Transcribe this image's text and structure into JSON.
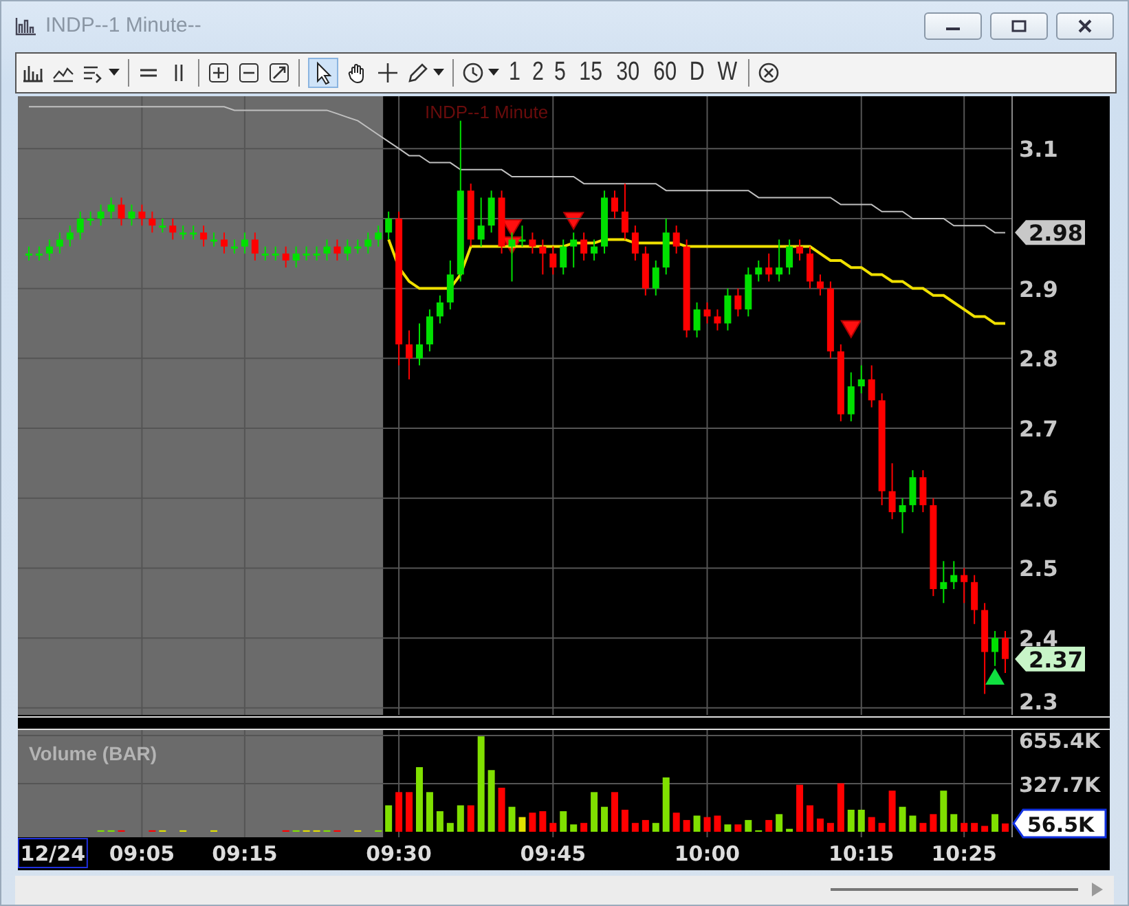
{
  "window": {
    "title": "INDP--1 Minute--"
  },
  "toolbar": {
    "periods": [
      {
        "label": "1"
      },
      {
        "label": "2"
      },
      {
        "label": "5"
      },
      {
        "label": "15"
      },
      {
        "label": "30"
      },
      {
        "label": "60"
      },
      {
        "label": "D"
      },
      {
        "label": "W"
      }
    ]
  },
  "chart": {
    "title": "INDP--1 Minute",
    "price": {
      "badges": [
        {
          "text": "2.98",
          "kind": "average",
          "color": "#c8c8c8"
        },
        {
          "text": "2.37",
          "kind": "last",
          "color": "#c8f5c8"
        }
      ],
      "chart_data": {
        "type": "candlestick",
        "grid": true,
        "ylim": [
          2.29,
          3.175
        ],
        "yticks": [
          {
            "value": 3.1,
            "label": "3.1"
          },
          {
            "value": 2.9,
            "label": "2.9"
          },
          {
            "value": 2.8,
            "label": "2.8"
          },
          {
            "value": 2.7,
            "label": "2.7"
          },
          {
            "value": 2.6,
            "label": "2.6"
          },
          {
            "value": 2.5,
            "label": "2.5"
          },
          {
            "value": 2.4,
            "label": "2.4"
          },
          {
            "value": 2.3,
            "label": "2.3"
          }
        ],
        "ohlc": [
          [
            2.95,
            2.96,
            2.94,
            2.95
          ],
          [
            2.95,
            2.96,
            2.94,
            2.95
          ],
          [
            2.95,
            2.97,
            2.94,
            2.96
          ],
          [
            2.96,
            2.98,
            2.95,
            2.97
          ],
          [
            2.97,
            2.99,
            2.96,
            2.98
          ],
          [
            2.98,
            3.01,
            2.97,
            3.0
          ],
          [
            3.0,
            3.01,
            2.99,
            3.0
          ],
          [
            3.0,
            3.02,
            2.99,
            3.01
          ],
          [
            3.01,
            3.03,
            3.0,
            3.02
          ],
          [
            3.02,
            3.03,
            2.99,
            3.0
          ],
          [
            3.0,
            3.02,
            2.99,
            3.01
          ],
          [
            3.01,
            3.02,
            2.99,
            3.0
          ],
          [
            3.0,
            3.01,
            2.98,
            2.99
          ],
          [
            2.99,
            3.0,
            2.98,
            2.99
          ],
          [
            2.99,
            3.0,
            2.97,
            2.98
          ],
          [
            2.98,
            2.99,
            2.97,
            2.98
          ],
          [
            2.98,
            2.99,
            2.97,
            2.98
          ],
          [
            2.98,
            2.99,
            2.96,
            2.97
          ],
          [
            2.97,
            2.98,
            2.96,
            2.97
          ],
          [
            2.97,
            2.98,
            2.95,
            2.96
          ],
          [
            2.96,
            2.97,
            2.95,
            2.96
          ],
          [
            2.96,
            2.98,
            2.95,
            2.97
          ],
          [
            2.97,
            2.98,
            2.94,
            2.95
          ],
          [
            2.95,
            2.96,
            2.94,
            2.95
          ],
          [
            2.95,
            2.96,
            2.94,
            2.95
          ],
          [
            2.95,
            2.96,
            2.93,
            2.94
          ],
          [
            2.94,
            2.96,
            2.93,
            2.95
          ],
          [
            2.95,
            2.96,
            2.94,
            2.95
          ],
          [
            2.95,
            2.96,
            2.94,
            2.95
          ],
          [
            2.95,
            2.97,
            2.94,
            2.96
          ],
          [
            2.96,
            2.97,
            2.94,
            2.95
          ],
          [
            2.95,
            2.97,
            2.94,
            2.96
          ],
          [
            2.96,
            2.97,
            2.95,
            2.96
          ],
          [
            2.96,
            2.98,
            2.95,
            2.97
          ],
          [
            2.97,
            2.99,
            2.96,
            2.98
          ],
          [
            2.98,
            3.01,
            2.97,
            3.0
          ],
          [
            3.0,
            3.01,
            2.79,
            2.82
          ],
          [
            2.82,
            2.84,
            2.77,
            2.8
          ],
          [
            2.8,
            2.85,
            2.79,
            2.82
          ],
          [
            2.82,
            2.87,
            2.81,
            2.86
          ],
          [
            2.86,
            2.89,
            2.85,
            2.88
          ],
          [
            2.88,
            2.94,
            2.87,
            2.92
          ],
          [
            2.92,
            3.14,
            2.91,
            3.04
          ],
          [
            3.04,
            3.05,
            2.96,
            2.97
          ],
          [
            2.97,
            3.03,
            2.96,
            2.99
          ],
          [
            2.99,
            3.04,
            2.98,
            3.03
          ],
          [
            3.03,
            3.04,
            2.95,
            2.96
          ],
          [
            2.96,
            2.98,
            2.91,
            2.97
          ],
          [
            2.97,
            2.99,
            2.96,
            2.97
          ],
          [
            2.97,
            2.98,
            2.95,
            2.96
          ],
          [
            2.96,
            2.97,
            2.92,
            2.95
          ],
          [
            2.95,
            2.96,
            2.92,
            2.93
          ],
          [
            2.93,
            2.97,
            2.92,
            2.96
          ],
          [
            2.96,
            2.98,
            2.93,
            2.97
          ],
          [
            2.97,
            2.98,
            2.94,
            2.95
          ],
          [
            2.95,
            2.97,
            2.94,
            2.96
          ],
          [
            2.96,
            3.04,
            2.95,
            3.03
          ],
          [
            3.03,
            3.04,
            3.0,
            3.01
          ],
          [
            3.01,
            3.05,
            2.97,
            2.98
          ],
          [
            2.98,
            2.99,
            2.94,
            2.95
          ],
          [
            2.95,
            2.96,
            2.89,
            2.9
          ],
          [
            2.9,
            2.94,
            2.89,
            2.93
          ],
          [
            2.93,
            3.0,
            2.92,
            2.98
          ],
          [
            2.98,
            2.99,
            2.95,
            2.96
          ],
          [
            2.96,
            2.97,
            2.83,
            2.84
          ],
          [
            2.84,
            2.88,
            2.83,
            2.87
          ],
          [
            2.87,
            2.88,
            2.85,
            2.86
          ],
          [
            2.86,
            2.87,
            2.84,
            2.85
          ],
          [
            2.85,
            2.9,
            2.84,
            2.89
          ],
          [
            2.89,
            2.9,
            2.86,
            2.87
          ],
          [
            2.87,
            2.93,
            2.86,
            2.92
          ],
          [
            2.92,
            2.94,
            2.91,
            2.93
          ],
          [
            2.93,
            2.95,
            2.91,
            2.92
          ],
          [
            2.92,
            2.97,
            2.91,
            2.93
          ],
          [
            2.93,
            2.97,
            2.92,
            2.96
          ],
          [
            2.96,
            2.97,
            2.94,
            2.95
          ],
          [
            2.95,
            2.96,
            2.9,
            2.91
          ],
          [
            2.91,
            2.92,
            2.89,
            2.9
          ],
          [
            2.9,
            2.91,
            2.8,
            2.81
          ],
          [
            2.81,
            2.82,
            2.71,
            2.72
          ],
          [
            2.72,
            2.78,
            2.71,
            2.76
          ],
          [
            2.76,
            2.79,
            2.75,
            2.77
          ],
          [
            2.77,
            2.79,
            2.73,
            2.74
          ],
          [
            2.74,
            2.75,
            2.59,
            2.61
          ],
          [
            2.61,
            2.65,
            2.57,
            2.58
          ],
          [
            2.58,
            2.6,
            2.55,
            2.59
          ],
          [
            2.59,
            2.64,
            2.58,
            2.63
          ],
          [
            2.63,
            2.64,
            2.58,
            2.59
          ],
          [
            2.59,
            2.6,
            2.46,
            2.47
          ],
          [
            2.47,
            2.51,
            2.45,
            2.48
          ],
          [
            2.48,
            2.51,
            2.47,
            2.49
          ],
          [
            2.49,
            2.5,
            2.45,
            2.48
          ],
          [
            2.48,
            2.49,
            2.42,
            2.44
          ],
          [
            2.44,
            2.45,
            2.32,
            2.38
          ],
          [
            2.38,
            2.41,
            2.36,
            2.4
          ],
          [
            2.4,
            2.41,
            2.35,
            2.37
          ]
        ],
        "series": [
          {
            "type": "line",
            "color": "#c0c0c0",
            "values": [
              3.16,
              3.16,
              3.16,
              3.16,
              3.16,
              3.16,
              3.16,
              3.16,
              3.16,
              3.16,
              3.16,
              3.16,
              3.16,
              3.16,
              3.16,
              3.16,
              3.16,
              3.16,
              3.16,
              3.16,
              3.155,
              3.155,
              3.155,
              3.155,
              3.155,
              3.155,
              3.155,
              3.155,
              3.155,
              3.155,
              3.15,
              3.145,
              3.14,
              3.13,
              3.12,
              3.11,
              3.1,
              3.09,
              3.09,
              3.08,
              3.08,
              3.08,
              3.07,
              3.07,
              3.07,
              3.07,
              3.07,
              3.06,
              3.06,
              3.06,
              3.06,
              3.06,
              3.06,
              3.06,
              3.05,
              3.05,
              3.05,
              3.05,
              3.05,
              3.05,
              3.05,
              3.05,
              3.04,
              3.04,
              3.04,
              3.04,
              3.04,
              3.04,
              3.04,
              3.04,
              3.04,
              3.03,
              3.03,
              3.03,
              3.03,
              3.03,
              3.03,
              3.03,
              3.03,
              3.02,
              3.02,
              3.02,
              3.02,
              3.01,
              3.01,
              3.01,
              3.0,
              3.0,
              3.0,
              3.0,
              2.99,
              2.99,
              2.99,
              2.99,
              2.98,
              2.98
            ]
          },
          {
            "type": "line",
            "color": "#f0e000",
            "values": [
              null,
              null,
              null,
              null,
              null,
              null,
              null,
              null,
              null,
              null,
              null,
              null,
              null,
              null,
              null,
              null,
              null,
              null,
              null,
              null,
              null,
              null,
              null,
              null,
              null,
              null,
              null,
              null,
              null,
              null,
              null,
              null,
              null,
              null,
              null,
              2.97,
              2.93,
              2.91,
              2.9,
              2.9,
              2.9,
              2.9,
              2.92,
              2.96,
              2.96,
              2.96,
              2.96,
              2.96,
              2.96,
              2.96,
              2.96,
              2.96,
              2.96,
              2.965,
              2.965,
              2.965,
              2.97,
              2.97,
              2.97,
              2.965,
              2.965,
              2.965,
              2.965,
              2.965,
              2.96,
              2.96,
              2.96,
              2.96,
              2.96,
              2.96,
              2.96,
              2.96,
              2.96,
              2.96,
              2.96,
              2.96,
              2.96,
              2.95,
              2.94,
              2.94,
              2.93,
              2.93,
              2.92,
              2.92,
              2.91,
              2.91,
              2.9,
              2.9,
              2.89,
              2.89,
              2.88,
              2.87,
              2.86,
              2.86,
              2.85,
              2.85
            ]
          }
        ]
      }
    },
    "volume": {
      "badge": {
        "text": "56.5K"
      },
      "time_labels": [
        "12/24",
        "09:05",
        "09:15",
        "09:30",
        "09:45",
        "10:00",
        "10:15",
        "10:25"
      ],
      "chart_data": {
        "type": "bar",
        "title": "Volume (BAR)",
        "grid": true,
        "ylim": [
          0,
          655.4
        ],
        "yticks": [
          {
            "value": 655.4,
            "label": "655.4K"
          },
          {
            "value": 327.7,
            "label": "327.7K"
          }
        ],
        "values": [
          0,
          0,
          0,
          0,
          0,
          0,
          0,
          10,
          10,
          10,
          0,
          0,
          10,
          10,
          0,
          10,
          0,
          0,
          10,
          0,
          0,
          0,
          0,
          0,
          0,
          10,
          10,
          10,
          10,
          10,
          10,
          0,
          10,
          0,
          10,
          180,
          270,
          270,
          440,
          270,
          140,
          60,
          180,
          180,
          650,
          420,
          300,
          170,
          100,
          130,
          140,
          60,
          140,
          50,
          60,
          270,
          170,
          270,
          150,
          60,
          80,
          60,
          370,
          130,
          80,
          110,
          100,
          110,
          50,
          50,
          80,
          10,
          80,
          120,
          20,
          320,
          180,
          90,
          60,
          330,
          150,
          150,
          100,
          60,
          280,
          170,
          110,
          60,
          120,
          280,
          120,
          60,
          60,
          40,
          120,
          56.5
        ]
      }
    }
  }
}
